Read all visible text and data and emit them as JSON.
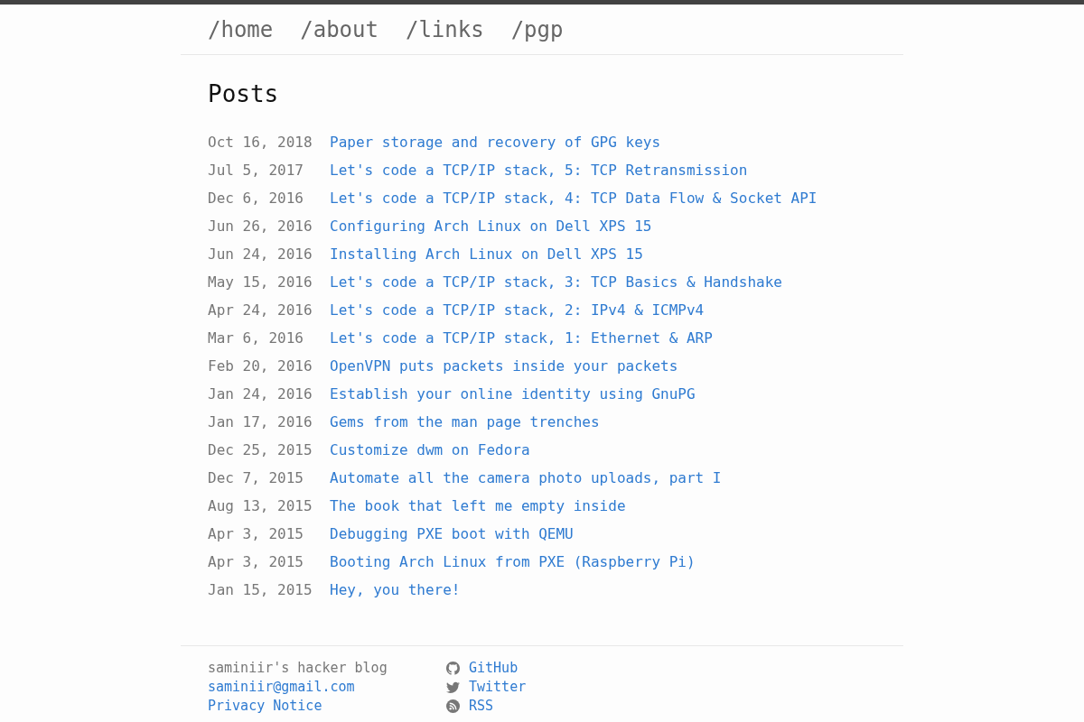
{
  "nav": {
    "links": [
      {
        "label": "/home"
      },
      {
        "label": "/about"
      },
      {
        "label": "/links"
      },
      {
        "label": "/pgp"
      }
    ]
  },
  "posts": {
    "title": "Posts",
    "items": [
      {
        "date": "Oct 16, 2018",
        "title": "Paper storage and recovery of GPG keys"
      },
      {
        "date": "Jul 5, 2017",
        "title": "Let's code a TCP/IP stack, 5: TCP Retransmission"
      },
      {
        "date": "Dec 6, 2016",
        "title": "Let's code a TCP/IP stack, 4: TCP Data Flow & Socket API"
      },
      {
        "date": "Jun 26, 2016",
        "title": "Configuring Arch Linux on Dell XPS 15"
      },
      {
        "date": "Jun 24, 2016",
        "title": "Installing Arch Linux on Dell XPS 15"
      },
      {
        "date": "May 15, 2016",
        "title": "Let's code a TCP/IP stack, 3: TCP Basics & Handshake"
      },
      {
        "date": "Apr 24, 2016",
        "title": "Let's code a TCP/IP stack, 2: IPv4 & ICMPv4"
      },
      {
        "date": "Mar 6, 2016",
        "title": "Let's code a TCP/IP stack, 1: Ethernet & ARP"
      },
      {
        "date": "Feb 20, 2016",
        "title": "OpenVPN puts packets inside your packets"
      },
      {
        "date": "Jan 24, 2016",
        "title": "Establish your online identity using GnuPG"
      },
      {
        "date": "Jan 17, 2016",
        "title": "Gems from the man page trenches"
      },
      {
        "date": "Dec 25, 2015",
        "title": "Customize dwm on Fedora"
      },
      {
        "date": "Dec 7, 2015",
        "title": "Automate all the camera photo uploads, part I"
      },
      {
        "date": "Aug 13, 2015",
        "title": "The book that left me empty inside"
      },
      {
        "date": "Apr 3, 2015",
        "title": "Debugging PXE boot with QEMU"
      },
      {
        "date": "Apr 3, 2015",
        "title": "Booting Arch Linux from PXE (Raspberry Pi)"
      },
      {
        "date": "Jan 15, 2015",
        "title": "Hey, you there!"
      }
    ]
  },
  "footer": {
    "blog_name": "saminiir's hacker blog",
    "links": [
      {
        "label": "saminiir@gmail.com"
      },
      {
        "label": "Privacy Notice"
      }
    ],
    "social": [
      {
        "kind": "github",
        "label": "GitHub"
      },
      {
        "kind": "twitter",
        "label": "Twitter"
      },
      {
        "kind": "rss",
        "label": "RSS"
      }
    ]
  }
}
